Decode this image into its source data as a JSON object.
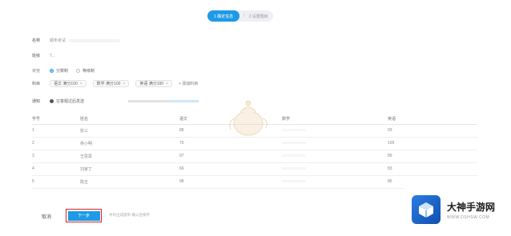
{
  "steps": {
    "active": "1 确定信息",
    "separator": "/",
    "next": "2 设置题目"
  },
  "form": {
    "name": {
      "label": "名称",
      "value": "期末考试"
    },
    "class": {
      "label": "班级",
      "value": "T..."
    },
    "scoring": {
      "label": "计分",
      "options": [
        "分数制",
        "等级制"
      ],
      "selected": 0
    },
    "subjects": {
      "label": "科目",
      "tags": [
        "语文 满分100",
        "数学 满分100",
        "英语 满分100"
      ],
      "add": "添加科目"
    },
    "notify": {
      "label": "通知",
      "value": "在答题过后发送"
    }
  },
  "table": {
    "headers": [
      "学号",
      "姓名",
      "语文",
      "数学",
      "英语"
    ],
    "rows": [
      [
        "1",
        "张三",
        "88",
        "",
        "93"
      ],
      [
        "2",
        "林小明",
        "75",
        "",
        "100"
      ],
      [
        "3",
        "王思思",
        "97",
        "",
        "89"
      ],
      [
        "4",
        "刘家丁",
        "66",
        "",
        "83"
      ],
      [
        "5",
        "陈五",
        "98",
        "",
        "85"
      ]
    ]
  },
  "footer": {
    "cancel": "取消",
    "next": "下一步",
    "hint": "并导出成绩单·确认后保存"
  },
  "brand": {
    "name": "大神手游网",
    "url": "WWW.DSHSW.COM"
  },
  "colors": {
    "accent": "#1e9ae6",
    "highlight": "#d92020"
  }
}
